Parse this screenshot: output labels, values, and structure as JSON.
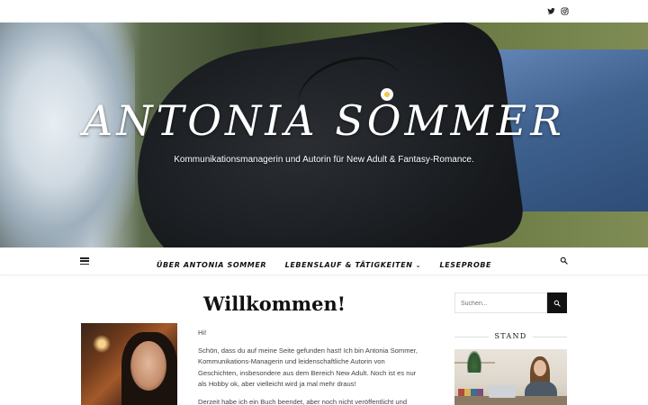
{
  "social": {
    "twitter_icon": "twitter-icon",
    "instagram_icon": "instagram-icon"
  },
  "hero": {
    "title": "ANTONIA SOMMER",
    "subtitle": "Kommunikationsmanagerin und Autorin für New Adult & Fantasy-Romance."
  },
  "nav": {
    "menu_icon": "hamburger-menu-icon",
    "items": [
      {
        "label": "ÜBER ANTONIA SOMMER",
        "has_dropdown": false
      },
      {
        "label": "LEBENSLAUF & TÄTIGKEITEN",
        "has_dropdown": true
      },
      {
        "label": "LESEPROBE",
        "has_dropdown": false
      }
    ],
    "search_icon": "search-icon"
  },
  "main": {
    "heading": "Willkommen!",
    "paragraphs": [
      "Hi!",
      "Schön, dass du auf meine Seite gefunden hast! Ich bin Antonia Sommer, Kommunikations-Managerin und leidenschaftliche Autorin von Geschichten, insbesondere aus dem Bereich New Adult. Noch ist es nur als Hobby ok, aber vielleicht wird ja mal mehr draus!",
      "Derzeit habe ich ein Buch beendet, aber noch nicht veröffentlicht und"
    ]
  },
  "sidebar": {
    "search_placeholder": "Suchen...",
    "widget_title": "STAND"
  },
  "colors": {
    "text": "#333333",
    "heading": "#111111",
    "button_bg": "#111111",
    "hero_text": "#ffffff"
  }
}
